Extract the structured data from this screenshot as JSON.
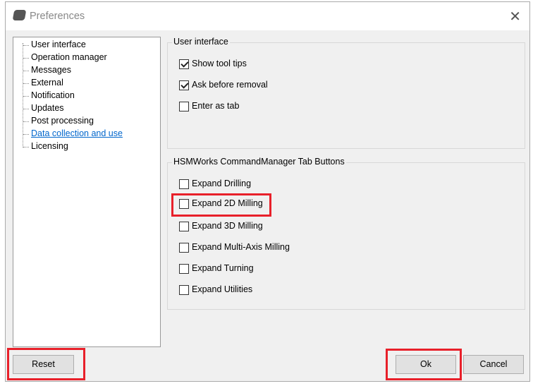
{
  "window": {
    "title": "Preferences",
    "close": "✕"
  },
  "tree": [
    "User interface",
    "Operation manager",
    "Messages",
    "External",
    "Notification",
    "Updates",
    "Post processing",
    "Data collection and use",
    "Licensing"
  ],
  "group1": {
    "label": "User interface",
    "items": [
      {
        "label": "Show tool tips",
        "checked": true
      },
      {
        "label": "Ask before removal",
        "checked": true
      },
      {
        "label": "Enter as tab",
        "checked": false
      }
    ]
  },
  "group2": {
    "label": "HSMWorks CommandManager Tab Buttons",
    "items": [
      {
        "label": "Expand Drilling",
        "checked": false
      },
      {
        "label": "Expand 2D Milling",
        "checked": false
      },
      {
        "label": "Expand 3D Milling",
        "checked": false
      },
      {
        "label": "Expand Multi-Axis Milling",
        "checked": false
      },
      {
        "label": "Expand Turning",
        "checked": false
      },
      {
        "label": "Expand Utilities",
        "checked": false
      }
    ]
  },
  "buttons": {
    "reset": "Reset",
    "ok": "Ok",
    "cancel": "Cancel"
  },
  "colors": {
    "highlight": "#e8202a",
    "link": "#0066cc"
  }
}
